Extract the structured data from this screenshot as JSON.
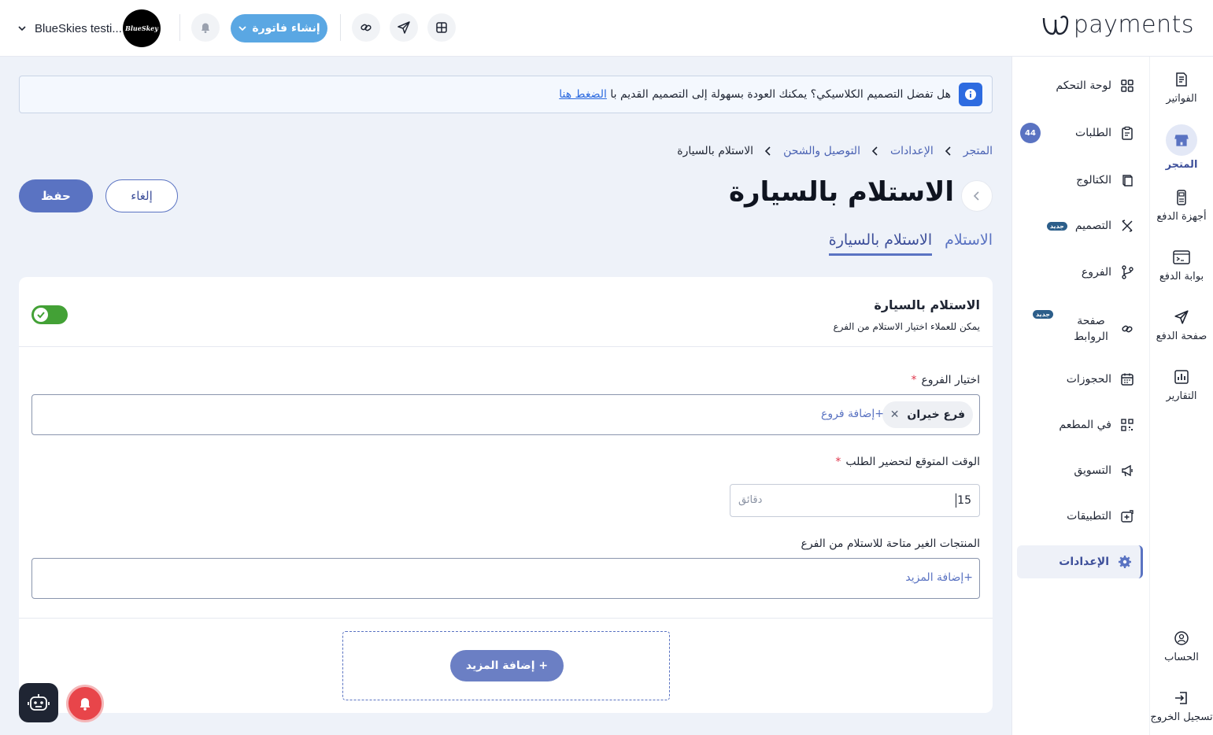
{
  "header": {
    "logo_text": "payments",
    "account_name": "BlueSkies testi...",
    "avatar_text": "BlueSkey",
    "create_invoice_label": "إنشاء فاتورة"
  },
  "rail": [
    {
      "label": "الفواتير",
      "icon": "invoice-icon"
    },
    {
      "label": "المتجر",
      "icon": "store-icon",
      "active": true
    },
    {
      "label": "أجهزة الدفع",
      "icon": "pos-device-icon"
    },
    {
      "label": "بوابة الدفع",
      "icon": "gateway-icon"
    },
    {
      "label": "صفحة الدفع",
      "icon": "send-icon"
    },
    {
      "label": "التقارير",
      "icon": "reports-icon"
    },
    {
      "label": "الحساب",
      "icon": "account-icon"
    },
    {
      "label": "تسجيل الخروج",
      "icon": "logout-icon"
    }
  ],
  "submenu": [
    {
      "label": "لوحة التحكم",
      "icon": "dashboard-icon"
    },
    {
      "label": "الطلبات",
      "icon": "orders-icon",
      "count": "44"
    },
    {
      "label": "الكتالوج",
      "icon": "catalog-icon"
    },
    {
      "label": "التصميم",
      "icon": "design-icon",
      "badge": "جديد"
    },
    {
      "label": "الفروع",
      "icon": "branches-icon"
    },
    {
      "label": "صفحة الروابط",
      "icon": "links-icon",
      "badge": "جديد"
    },
    {
      "label": "الحجوزات",
      "icon": "calendar-icon"
    },
    {
      "label": "في المطعم",
      "icon": "qr-icon"
    },
    {
      "label": "التسويق",
      "icon": "megaphone-icon"
    },
    {
      "label": "التطبيقات",
      "icon": "apps-icon"
    },
    {
      "label": "الإعدادات",
      "icon": "settings-icon",
      "active": true
    }
  ],
  "notice": {
    "text": "هل تفضل التصميم الكلاسيكي؟ يمكنك العودة بسهولة إلى التصميم القديم با",
    "link": "الضغط هنا"
  },
  "breadcrumb": [
    "المتجر",
    "الإعدادات",
    "التوصيل والشحن",
    "الاستلام بالسيارة"
  ],
  "page": {
    "title": "الاستلام بالسيارة",
    "cancel_label": "إلغاء",
    "save_label": "حفظ"
  },
  "tabs": [
    {
      "label": "الاستلام",
      "active": false
    },
    {
      "label": "الاستلام بالسيارة",
      "active": true
    }
  ],
  "card": {
    "title": "الاستلام بالسيارة",
    "subtitle": "يمكن للعملاء اختيار الاستلام من الفرع",
    "toggle_on": true,
    "branches_label": "اختيار الفروع",
    "required_mark": "*",
    "branch_chip": "فرع خيران",
    "add_branches": "+إضافة فروع",
    "prep_time_label": "الوقت المتوقع لتحضير الطلب",
    "prep_time_value": "15",
    "prep_time_unit": "دقائق",
    "unavailable_label": "المنتجات الغير متاحة للاستلام من الفرع",
    "add_more_products": "+إضافة المزيد",
    "add_more_button": "+ إضافة المزيد"
  },
  "colors": {
    "primary": "#5a73c2",
    "invoice_button": "#5aa7e3",
    "toggle_on": "#43a136",
    "info": "#2d6be0",
    "alert": "#e8454a"
  }
}
